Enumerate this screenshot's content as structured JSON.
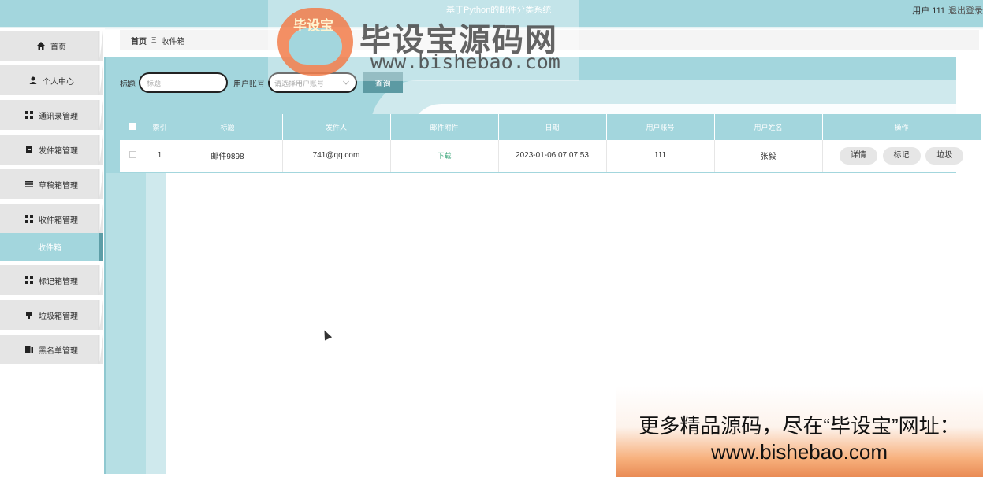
{
  "header": {
    "system_title": "基于Python的邮件分类系统",
    "user_label": "用户 111",
    "logout": "退出登录"
  },
  "sidebar": {
    "items": [
      {
        "label": "首页",
        "icon": "home-icon"
      },
      {
        "label": "个人中心",
        "icon": "user-icon"
      },
      {
        "label": "通讯录管理",
        "icon": "grid-icon"
      },
      {
        "label": "发件箱管理",
        "icon": "clipboard-icon"
      },
      {
        "label": "草稿箱管理",
        "icon": "list-icon"
      },
      {
        "label": "收件箱管理",
        "icon": "grid-icon"
      },
      {
        "label": "标记箱管理",
        "icon": "grid-icon"
      },
      {
        "label": "垃圾箱管理",
        "icon": "trash-icon"
      },
      {
        "label": "黑名单管理",
        "icon": "book-icon"
      }
    ],
    "active_sub": "收件箱"
  },
  "breadcrumb": {
    "home": "首页",
    "sep": "Ξ",
    "current": "收件箱"
  },
  "search": {
    "title_label": "标题",
    "title_placeholder": "标题",
    "account_label": "用户账号",
    "account_placeholder": "请选择用户账号",
    "query_button": "查询"
  },
  "table": {
    "headers": [
      "",
      "索引",
      "标题",
      "发件人",
      "邮件附件",
      "日期",
      "用户账号",
      "用户姓名",
      "操作"
    ],
    "rows": [
      {
        "index": "1",
        "title": "邮件9898",
        "sender": "741@qq.com",
        "attachment": "下载",
        "date": "2023-01-06 07:07:53",
        "account": "111",
        "name": "张毅",
        "actions": [
          "详情",
          "标记",
          "垃圾"
        ]
      }
    ]
  },
  "watermark": {
    "logo_text": "毕设宝",
    "brand": "毕设宝源码网",
    "url": "www.bishebao.com"
  },
  "promo": {
    "line1": "更多精品源码，尽在“毕设宝”网址：",
    "line2": "www.bishebao.com"
  },
  "colors": {
    "accent": "#a3d6dd",
    "button": "#5c9aa3",
    "download": "#3aa67a"
  }
}
